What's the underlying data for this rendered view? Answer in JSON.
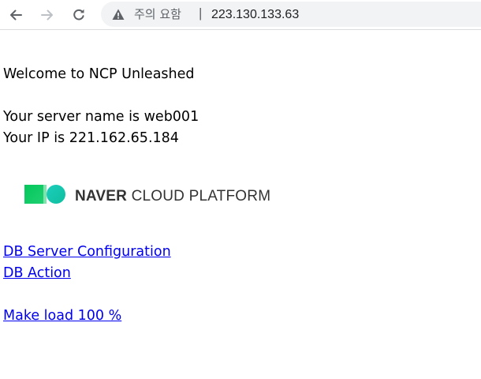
{
  "browser": {
    "back_icon": "arrow-left-icon",
    "forward_icon": "arrow-right-icon",
    "reload_icon": "reload-icon",
    "warning_icon": "warning-triangle-icon",
    "not_secure_label": "주의 요함",
    "separator": "|",
    "url": "223.130.133.63"
  },
  "page": {
    "welcome": "Welcome to NCP Unleashed",
    "server_name_line": "Your server name is web001",
    "ip_line": "Your IP is 221.162.65.184",
    "logo": {
      "brand_bold": "NAVER",
      "brand_rest": " CLOUD PLATFORM",
      "colors": {
        "green": "#03c75a",
        "teal": "#1ccdbc"
      }
    },
    "links": {
      "db_server_configuration": "DB Server Configuration",
      "db_action": "DB Action",
      "make_load": "Make load 100 %"
    }
  }
}
